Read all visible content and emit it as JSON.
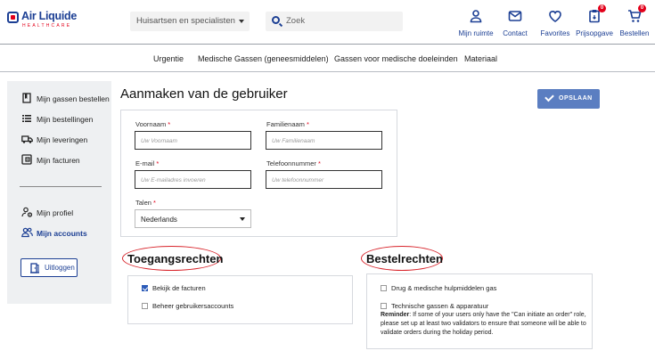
{
  "brand": {
    "name": "Air Liquide",
    "sub": "HEALTHCARE"
  },
  "header": {
    "category_select": "Huisartsen en specialisten",
    "search_placeholder": "Zoek",
    "nav": [
      {
        "label": "Mijn ruimte",
        "icon": "user-icon"
      },
      {
        "label": "Contact",
        "icon": "mail-icon"
      },
      {
        "label": "Favorites",
        "icon": "heart-icon"
      },
      {
        "label": "Prijsopgave",
        "icon": "clipboard-icon",
        "badge": "0"
      },
      {
        "label": "Bestellen",
        "icon": "cart-icon",
        "badge": "0"
      }
    ]
  },
  "main_nav": [
    "Urgentie",
    "Medische Gassen (geneesmiddelen)",
    "Gassen voor medische doeleinden",
    "Materiaal"
  ],
  "sidebar": {
    "items": [
      {
        "label": "Mijn gassen bestellen",
        "icon": "book-icon"
      },
      {
        "label": "Mijn bestellingen",
        "icon": "list-icon"
      },
      {
        "label": "Mijn leveringen",
        "icon": "truck-icon"
      },
      {
        "label": "Mijn facturen",
        "icon": "invoice-icon"
      }
    ],
    "account_items": [
      {
        "label": "Mijn profiel",
        "icon": "profile-settings-icon"
      },
      {
        "label": "Mijn accounts",
        "icon": "accounts-icon",
        "active": true
      }
    ],
    "logout": "Uitloggen"
  },
  "page": {
    "title": "Aanmaken van de gebruiker",
    "save": "OPSLAAN"
  },
  "form": {
    "first_name": {
      "label": "Voornaam",
      "req": "*",
      "placeholder": "Uw Voornaam"
    },
    "last_name": {
      "label": "Familienaam",
      "req": "*",
      "placeholder": "Uw Familienaam"
    },
    "email": {
      "label": "E-mail",
      "req": "*",
      "placeholder": "Uw E-mailadres invoeren"
    },
    "phone": {
      "label": "Telefoonnummer",
      "req": "*",
      "placeholder": "Uw telefoonnummer"
    },
    "language": {
      "label": "Talen",
      "req": "*",
      "value": "Nederlands"
    }
  },
  "access_rights": {
    "title": "Toegangsrechten",
    "options": [
      {
        "label": "Bekijk de facturen",
        "checked": true
      },
      {
        "label": "Beheer gebruikersaccounts",
        "checked": false
      }
    ]
  },
  "order_rights": {
    "title": "Bestelrechten",
    "options": [
      {
        "label": "Drug & medische hulpmiddelen gas",
        "checked": false
      },
      {
        "label": "Technische gassen & apparatuur",
        "checked": false
      }
    ],
    "reminder_label": "Reminder",
    "reminder_text": ": If some of your users only have the \"Can initiate an order\" role, please set up at least two validators to ensure that someone will be able to validate orders during the holiday period."
  },
  "colors": {
    "brand_blue": "#1c3f94",
    "brand_red": "#e2001a",
    "save_button": "#5b7ec1",
    "annotation_red": "#d8232a"
  }
}
